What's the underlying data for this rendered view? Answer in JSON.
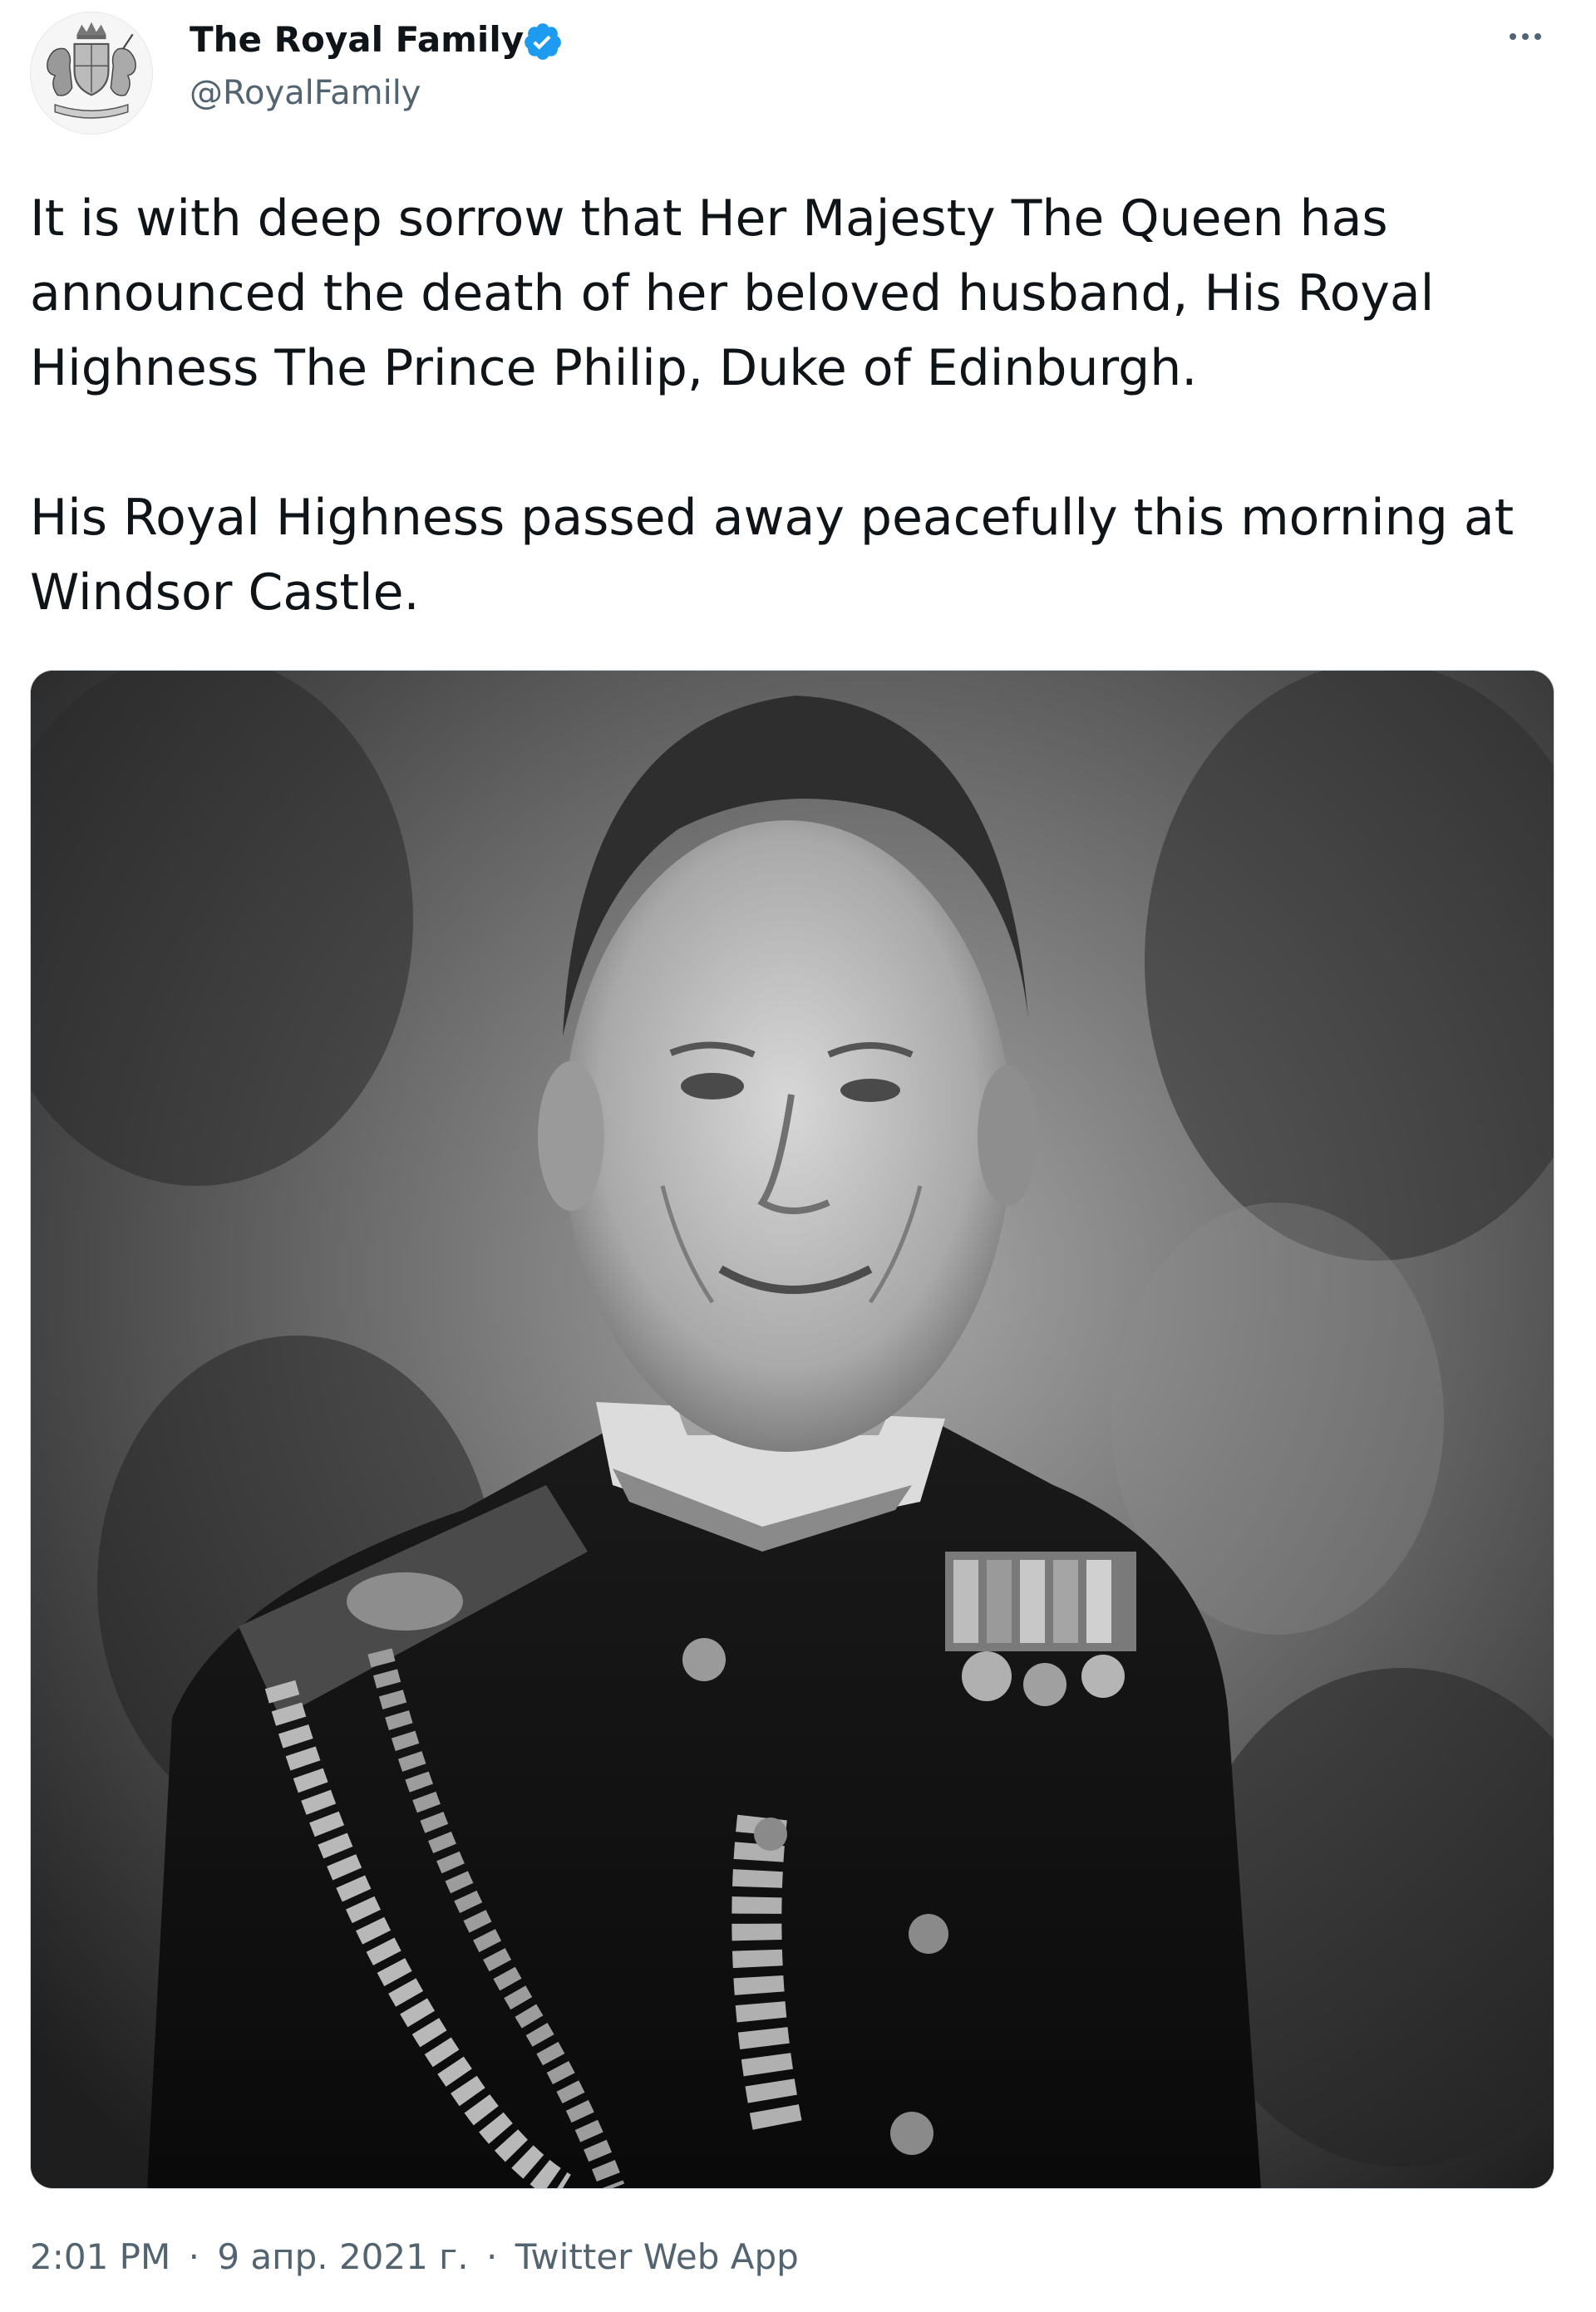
{
  "author": {
    "name": "The Royal Family",
    "handle": "@RoyalFamily",
    "verified": true,
    "avatar_icon": "royal-coat-of-arms"
  },
  "tweet": {
    "paragraphs": [
      "It is with deep sorrow that Her Majesty The Queen has announced the death of her beloved husband, His Royal Highness The Prince Philip, Duke of Edinburgh.",
      "His Royal Highness passed away peacefully this morning at Windsor Castle."
    ],
    "media": {
      "type": "photo",
      "style": "black-and-white portrait"
    }
  },
  "meta": {
    "time": "2:01 PM",
    "separator": "·",
    "date": "9 апр. 2021 г.",
    "source": "Twitter Web App"
  },
  "colors": {
    "text_primary": "#0f1419",
    "text_secondary": "#536471",
    "verified_blue": "#1d9bf0"
  }
}
